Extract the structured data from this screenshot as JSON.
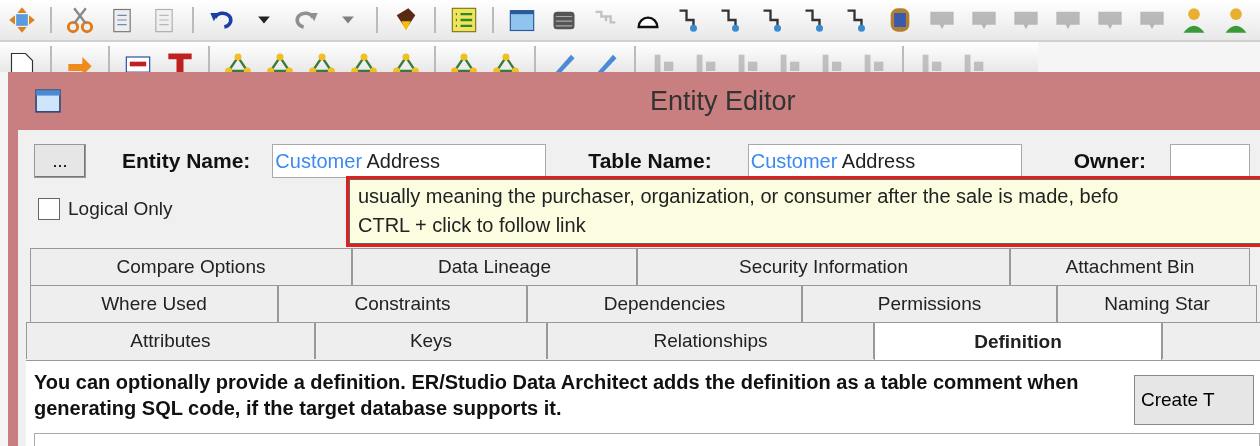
{
  "toolbar_1": [
    {
      "disabled": false
    },
    {
      "disabled": false
    },
    {
      "disabled": false
    },
    {
      "disabled": true
    },
    {
      "disabled": false
    },
    {
      "disabled": false
    },
    {
      "disabled": true
    },
    {
      "disabled": true
    },
    {
      "disabled": false
    },
    {
      "disabled": false
    },
    {
      "disabled": false
    },
    {
      "disabled": false
    },
    {
      "disabled": true
    },
    {
      "disabled": false
    },
    {
      "disabled": false
    },
    {
      "disabled": false
    },
    {
      "disabled": false
    },
    {
      "disabled": false
    },
    {
      "disabled": false
    },
    {
      "disabled": false
    },
    {
      "disabled": true
    },
    {
      "disabled": true
    },
    {
      "disabled": true
    },
    {
      "disabled": true
    },
    {
      "disabled": true
    },
    {
      "disabled": true
    },
    {
      "disabled": false
    },
    {
      "disabled": false
    }
  ],
  "toolbar_2": [
    {
      "disabled": false
    },
    {
      "disabled": false
    },
    {
      "disabled": false
    },
    {
      "disabled": false
    },
    {
      "disabled": false
    },
    {
      "disabled": false
    },
    {
      "disabled": false
    },
    {
      "disabled": false
    },
    {
      "disabled": false
    },
    {
      "disabled": false
    },
    {
      "disabled": false
    },
    {
      "disabled": false
    },
    {
      "disabled": false
    },
    {
      "disabled": true
    },
    {
      "disabled": true
    },
    {
      "disabled": true
    },
    {
      "disabled": true
    },
    {
      "disabled": true
    },
    {
      "disabled": true
    },
    {
      "disabled": true
    },
    {
      "disabled": true
    }
  ],
  "window": {
    "title": "Entity Editor"
  },
  "browse_button": "...",
  "entity_name": {
    "label": "Entity Name:",
    "value_parts": [
      {
        "text": "Customer",
        "kind": "link"
      },
      {
        "text": " Address",
        "kind": "plain"
      }
    ]
  },
  "table_name": {
    "label": "Table Name:",
    "value_parts": [
      {
        "text": "Customer",
        "kind": "link"
      },
      {
        "text": " Address",
        "kind": "plain"
      }
    ]
  },
  "owner": {
    "label": "Owner:"
  },
  "logical_only": {
    "label": "Logical Only",
    "checked": false
  },
  "tooltip": {
    "lines": [
      "usually meaning the purchaser, organization, or consumer after the sale is made, befo",
      "CTRL + click to follow link"
    ]
  },
  "tab_rows": [
    [
      {
        "label": "Compare Options",
        "selected": false
      },
      {
        "label": "Data Lineage",
        "selected": false
      },
      {
        "label": "Security Information",
        "selected": false
      },
      {
        "label": "Attachment Bin",
        "selected": false
      }
    ],
    [
      {
        "label": "Where Used",
        "selected": false
      },
      {
        "label": "Constraints",
        "selected": false
      },
      {
        "label": "Dependencies",
        "selected": false
      },
      {
        "label": "Permissions",
        "selected": false
      },
      {
        "label": "Naming Star",
        "selected": false
      }
    ],
    [
      {
        "label": "Attributes",
        "selected": false
      },
      {
        "label": "Keys",
        "selected": false
      },
      {
        "label": "Relationships",
        "selected": false
      },
      {
        "label": "Definition",
        "selected": true
      },
      {
        "selected": false
      }
    ]
  ],
  "definition_hint": "You can optionally provide a definition.  ER/Studio Data Architect adds the definition as a table comment when generating SQL code, if the target database supports it.",
  "create_button": "Create T"
}
